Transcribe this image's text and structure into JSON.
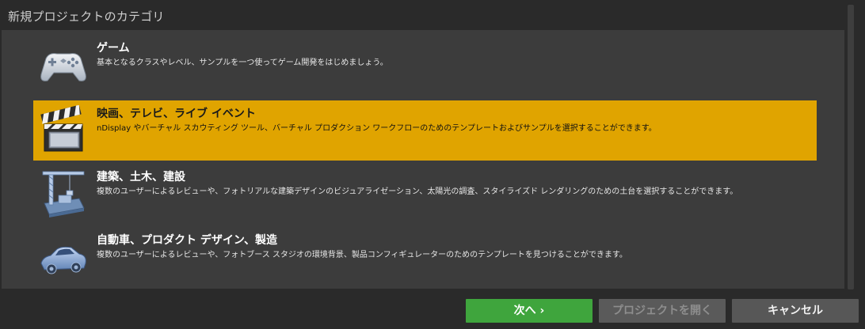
{
  "header": {
    "title": "新規プロジェクトのカテゴリ"
  },
  "categories": [
    {
      "title": "ゲーム",
      "description": "基本となるクラスやレベル、サンプルを一つ使ってゲーム開発をはじめましょう。",
      "icon": "gamepad-icon",
      "selected": false
    },
    {
      "title": "映画、テレビ、ライブ イベント",
      "description": "nDisplay やバーチャル スカウティング ツール、バーチャル プロダクション ワークフローのためのテンプレートおよびサンプルを選択することができます。",
      "icon": "clapperboard-icon",
      "selected": true
    },
    {
      "title": "建築、土木、建設",
      "description": "複数のユーザーによるレビューや、フォトリアルな建築デザインのビジュアライゼーション、太陽光の調査、スタイライズド レンダリングのための土台を選択することができます。",
      "icon": "crane-icon",
      "selected": false
    },
    {
      "title": "自動車、プロダクト デザイン、製造",
      "description": "複数のユーザーによるレビューや、フォトブース スタジオの環境背景、製品コンフィギュレーターのためのテンプレートを見つけることができます。",
      "icon": "car-icon",
      "selected": false
    }
  ],
  "footer": {
    "next_label": "次へ ›",
    "open_project_label": "プロジェクトを開く",
    "cancel_label": "キャンセル"
  },
  "colors": {
    "selected": "#e0a400",
    "next_button": "#3fa53d",
    "panel": "#3c3c3c"
  }
}
